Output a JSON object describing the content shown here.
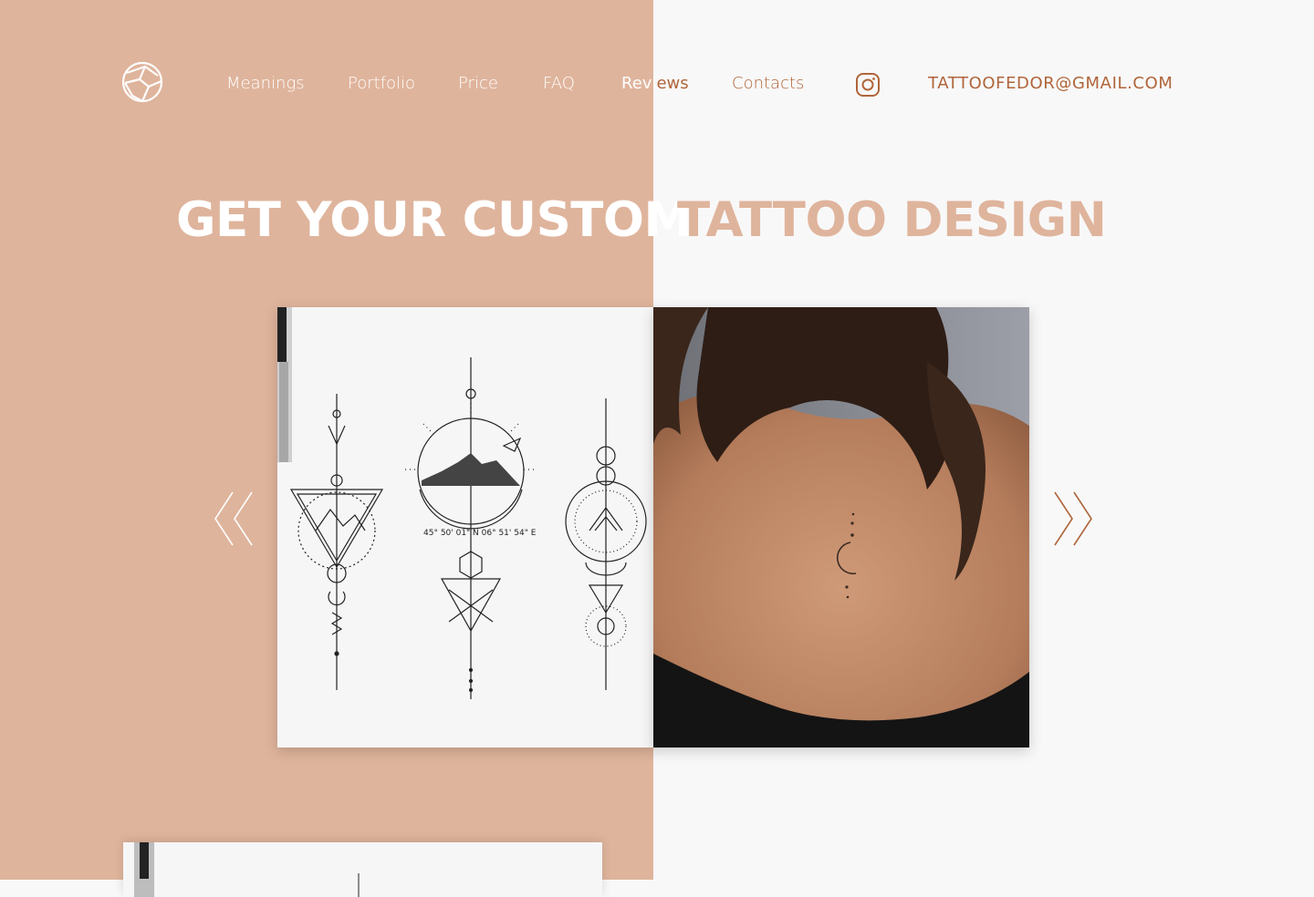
{
  "header": {
    "logo_icon": "sphere-logo-icon",
    "nav": [
      {
        "label": "Meanings"
      },
      {
        "label": "Portfolio"
      },
      {
        "label": "Price"
      },
      {
        "label": "FAQ"
      },
      {
        "label": "Reviews"
      },
      {
        "label": "Contacts"
      }
    ],
    "reviews_split": {
      "part_a": "Revi",
      "part_b": "ews"
    },
    "instagram_icon": "instagram-icon",
    "email": "TATTOOFEDOR@GMAIL.COM"
  },
  "hero": {
    "title_part1": "GET YOUR CUSTOM",
    "title_part2": "TATTOO DESIGN"
  },
  "slider": {
    "prev_icon": "double-chevron-left-icon",
    "next_icon": "double-chevron-right-icon",
    "slides": [
      {
        "image": "geometric-tattoo-sketches-image"
      },
      {
        "image": "moon-back-tattoo-photo"
      }
    ],
    "sketch_left_label": "45° 50' 01\" N   06° 51' 54\" E"
  },
  "colors": {
    "accent_bg": "#dfb49c",
    "accent_text": "#b0653a",
    "page_bg": "#f8f8f8"
  }
}
